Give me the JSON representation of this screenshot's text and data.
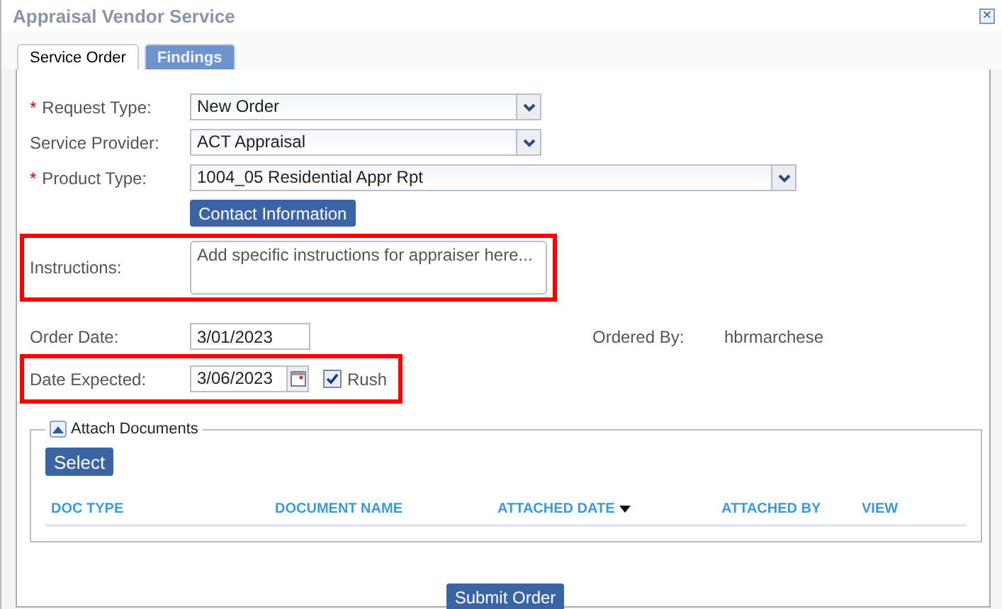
{
  "window": {
    "title": "Appraisal Vendor Service",
    "close_icon": "×"
  },
  "tabs": [
    {
      "label": "Service Order",
      "selected": true
    },
    {
      "label": "Findings",
      "selected": false
    }
  ],
  "fields": [
    {
      "kind": "select",
      "label": "Request Type:",
      "required_mark": "*",
      "value": "New Order"
    },
    {
      "kind": "select",
      "label": "Service Provider:",
      "value": "ACT Appraisal"
    },
    {
      "kind": "wideselect",
      "label": "Product Type:",
      "required_mark": "*",
      "value": "1004_05 Residential Appr Rpt"
    },
    {
      "kind": "button",
      "label": "Contact Information"
    },
    {
      "kind": "textarea",
      "label": "Instructions:",
      "placeholder": "Add specific instructions for appraiser here...",
      "highlighted": true
    },
    {
      "kind": "date",
      "label": "Order Date:",
      "value": "3/01/2023",
      "aside_label": "Ordered By:",
      "aside_value": "hbrmarchese"
    },
    {
      "kind": "datepicker",
      "label": "Date Expected:",
      "value": "3/06/2023",
      "checkbox": {
        "label": "Rush",
        "checked": true
      },
      "highlighted": true
    }
  ],
  "attach": {
    "legend": "Attach Documents",
    "expanded": true,
    "button": "Select",
    "columns": [
      {
        "label": "DOC TYPE",
        "sorted": false
      },
      {
        "label": "DOCUMENT NAME",
        "sorted": false
      },
      {
        "label": "ATTACHED DATE",
        "sorted": true
      },
      {
        "label": "ATTACHED BY",
        "sorted": false
      },
      {
        "label": "VIEW",
        "sorted": false
      }
    ]
  },
  "submit": "Submit Order"
}
